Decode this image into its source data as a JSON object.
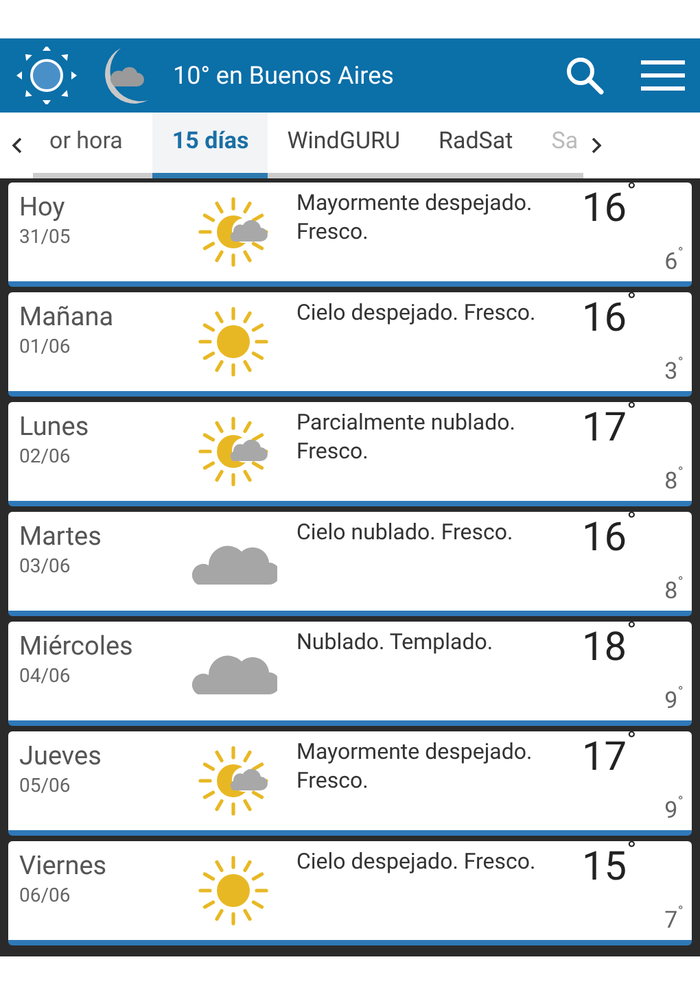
{
  "header": {
    "title": "10° en Buenos Aires"
  },
  "tabs": [
    {
      "label": "or hora",
      "selected": false
    },
    {
      "label": "15 días",
      "selected": true
    },
    {
      "label": "WindGURU",
      "selected": false
    },
    {
      "label": "RadSat",
      "selected": false
    },
    {
      "label": "Sa",
      "selected": false
    }
  ],
  "days": [
    {
      "day": "Hoy",
      "date": "31/05",
      "kind": "sun-cloud",
      "description": "Mayormente despejado. Fresco.",
      "high": "16$^{˚}$",
      "low": "6$^{˚}$"
    },
    {
      "day": "Mañana",
      "date": "01/06",
      "kind": "sun",
      "description": "Cielo despejado. Fresco.",
      "high": "16$^{˚}$",
      "low": "3$^{˚}$"
    },
    {
      "day": "Lunes",
      "date": "02/06",
      "kind": "sun-cloud",
      "description": "Parcialmente nublado. Fresco.",
      "high": "17$^{˚}$",
      "low": "8$^{˚}$"
    },
    {
      "day": "Martes",
      "date": "03/06",
      "kind": "cloud",
      "description": "Cielo nublado. Fresco.",
      "high": "16$^{˚}$",
      "low": "8$^{˚}$"
    },
    {
      "day": "Miércoles",
      "date": "04/06",
      "kind": "cloud",
      "description": "Nublado. Templado.",
      "high": "18$^{˚}$",
      "low": "9$^{˚}$"
    },
    {
      "day": "Jueves",
      "date": "05/06",
      "kind": "sun-cloud",
      "description": "Mayormente despejado. Fresco.",
      "high": "17$^{˚}$",
      "low": "9$^{˚}$"
    },
    {
      "day": "Viernes",
      "date": "06/06",
      "kind": "sun",
      "description": "Cielo despejado. Fresco.",
      "high": "15$^{˚}$",
      "low": "7$^{˚}$"
    }
  ]
}
